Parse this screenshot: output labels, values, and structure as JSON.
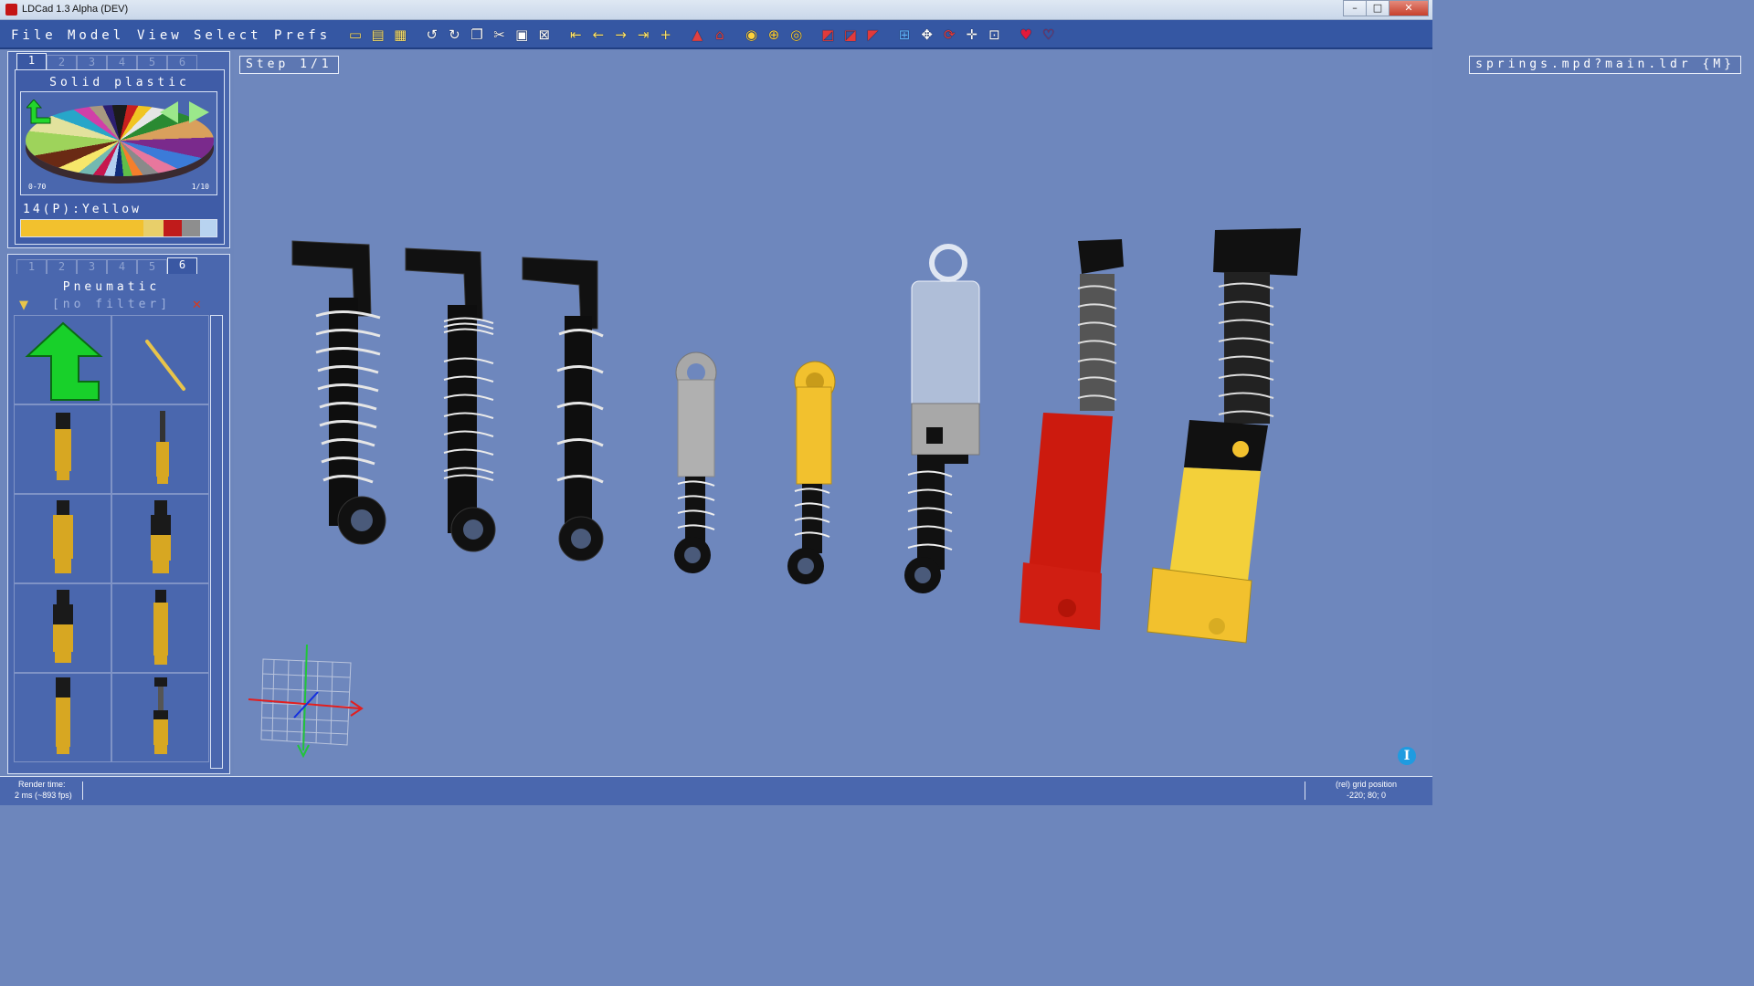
{
  "window": {
    "title": "LDCad 1.3 Alpha (DEV)",
    "minimize": "–",
    "maximize": "□",
    "close": "✕"
  },
  "menu": [
    "File",
    "Model",
    "View",
    "Select",
    "Prefs"
  ],
  "toolbar_icons": [
    "open-icon",
    "save-icon",
    "save-all-icon",
    "undo-icon",
    "redo-icon",
    "copy-icon",
    "cut-icon",
    "paste-icon",
    "delete-icon",
    "first-step-icon",
    "prev-step-icon",
    "next-step-icon",
    "last-step-icon",
    "add-step-icon",
    "group-icon",
    "ungroup-icon",
    "color-pick-icon",
    "color-apply-icon",
    "color-replace-icon",
    "hide-icon",
    "unhide-icon",
    "isolate-icon",
    "grid-icon",
    "move-icon",
    "rotate-icon",
    "pan-icon",
    "snap-icon",
    "favorite-icon",
    "unfavorite-icon"
  ],
  "color_panel": {
    "tabs": [
      "1",
      "2",
      "3",
      "4",
      "5",
      "6"
    ],
    "active_tab": "1",
    "title": "Solid plastic",
    "range_label": "0-70",
    "page_label": "1/10",
    "selected_color": "14(P):Yellow",
    "recent_swatches": [
      "#f2c12e",
      "#f2c12e",
      "#f2c12e",
      "#f2c12e",
      "#f2c12e",
      "#e8cf6a",
      "#c01b1b",
      "#8e8e8e",
      "#b8d3f0"
    ]
  },
  "parts_panel": {
    "tabs": [
      "1",
      "2",
      "3",
      "4",
      "5",
      "6"
    ],
    "active_tab": "6",
    "title": "Pneumatic",
    "filter": "[no filter]"
  },
  "viewport": {
    "step": "Step 1/1",
    "file": "springs.mpd?main.ldr {M}"
  },
  "status": {
    "render_label": "Render time:",
    "render_value": "2 ms (~893 fps)",
    "grid_label": "(rel) grid position",
    "grid_value": "-220; 80; 0"
  },
  "colors": {
    "accent": "#3557a3",
    "panel": "#4a67ae",
    "viewport": "#6e87bd"
  }
}
